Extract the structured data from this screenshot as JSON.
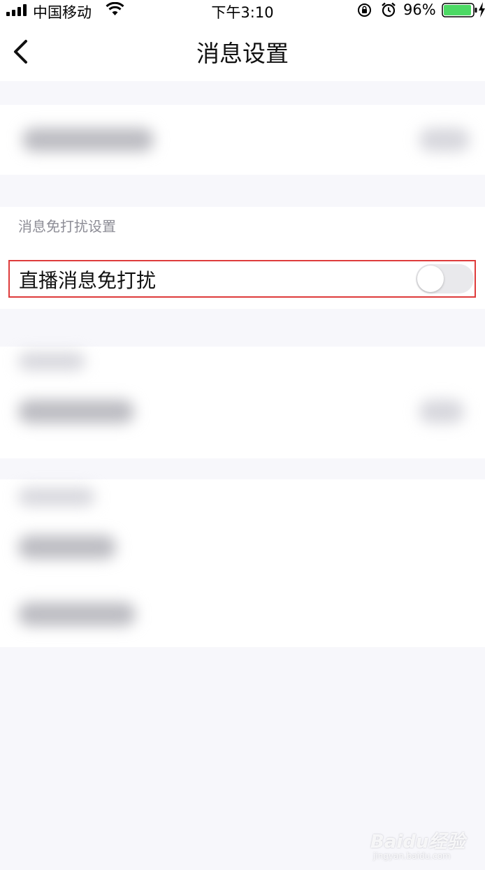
{
  "status_bar": {
    "carrier": "中国移动",
    "time": "下午3:10",
    "battery_percent": "96%",
    "battery_level": 0.96,
    "icons": [
      "signal-icon",
      "wifi-icon",
      "orientation-lock-icon",
      "alarm-icon",
      "battery-icon",
      "charging-icon"
    ]
  },
  "nav": {
    "back_icon": "chevron-left-icon",
    "title": "消息设置"
  },
  "do_not_disturb": {
    "section_title": "消息免打扰设置",
    "live_label": "直播消息免打扰",
    "live_enabled": false
  },
  "watermark": {
    "logo": "Baidu经验",
    "url": "jingyan.baidu.com"
  },
  "colors": {
    "highlight_border": "#de3b3b",
    "page_bg": "#f7f7fb",
    "battery_green": "#4cd964"
  }
}
